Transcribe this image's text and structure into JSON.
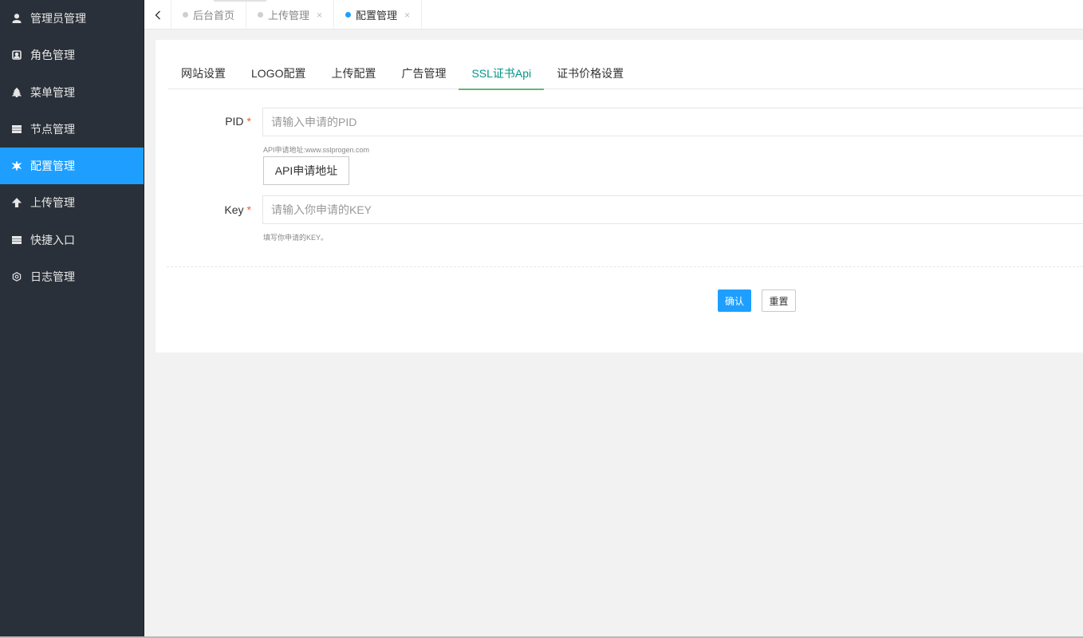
{
  "sidebar": {
    "items": [
      {
        "label": "管理员管理",
        "icon": "user-icon",
        "active": false
      },
      {
        "label": "角色管理",
        "icon": "role-icon",
        "active": false
      },
      {
        "label": "菜单管理",
        "icon": "tree-icon",
        "active": false
      },
      {
        "label": "节点管理",
        "icon": "list-icon",
        "active": false
      },
      {
        "label": "配置管理",
        "icon": "gear-icon",
        "active": true
      },
      {
        "label": "上传管理",
        "icon": "arrow-up-icon",
        "active": false
      },
      {
        "label": "快捷入口",
        "icon": "list-icon",
        "active": false
      },
      {
        "label": "日志管理",
        "icon": "hexagon-icon",
        "active": false
      }
    ]
  },
  "tabbar": {
    "tabs": [
      {
        "label": "后台首页",
        "closable": false,
        "active": false
      },
      {
        "label": "上传管理",
        "closable": true,
        "active": false
      },
      {
        "label": "配置管理",
        "closable": true,
        "active": true
      }
    ],
    "close_glyph": "×"
  },
  "subtabs": [
    "网站设置",
    "LOGO配置",
    "上传配置",
    "广告管理",
    "SSL证书Api",
    "证书价格设置"
  ],
  "form": {
    "pid": {
      "label": "PID",
      "required_mark": "*",
      "placeholder": "请输入申请的PID",
      "value": "",
      "hint": "API申请地址:www.sslprogen.com"
    },
    "api_button": "API申请地址",
    "key": {
      "label": "Key",
      "required_mark": "*",
      "placeholder": "请输入你申请的KEY",
      "value": "",
      "hint": "填写你申请的KEY。"
    },
    "submit": "确认",
    "reset": "重置"
  },
  "colors": {
    "sidebar_bg": "#2a3039",
    "active_blue": "#1e9fff",
    "active_tab_text": "#009688",
    "required": "#ff5722"
  }
}
